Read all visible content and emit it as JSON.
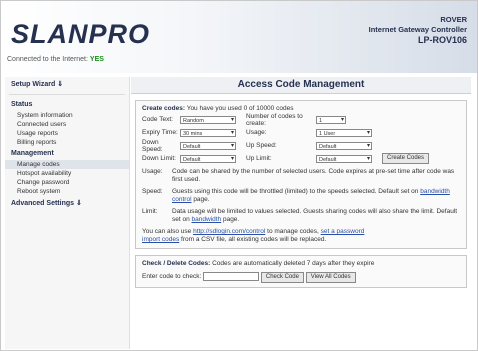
{
  "header": {
    "logo": "SLANPRO",
    "product_name": "ROVER",
    "product_desc": "Internet Gateway Controller",
    "model": "LP-ROV106",
    "connected_label": "Connected to the Internet:",
    "connected_value": "YES"
  },
  "sidebar": {
    "setup_wizard": "Setup Wizard ⇓",
    "status": "Status",
    "status_items": [
      "System information",
      "Connected users",
      "Usage reports",
      "Billing reports"
    ],
    "management": "Management",
    "management_items": [
      "Manage codes",
      "Hotspot availability",
      "Change password",
      "Reboot system"
    ],
    "advanced": "Advanced Settings ⇓"
  },
  "main": {
    "title": "Access Code Management",
    "create": {
      "title": "Create codes:",
      "info": "You have you used 0 of 10000 codes",
      "code_text_label": "Code Text:",
      "code_text_value": "Random",
      "num_codes_label": "Number of codes to create:",
      "num_codes_value": "1",
      "expiry_label": "Expiry Time:",
      "expiry_value": "30 mins",
      "usage_label": "Usage:",
      "usage_value": "1 User",
      "down_speed_label": "Down Speed:",
      "down_speed_value": "Default",
      "up_speed_label": "Up Speed:",
      "up_speed_value": "Default",
      "down_limit_label": "Down Limit:",
      "down_limit_value": "Default",
      "up_limit_label": "Up Limit:",
      "up_limit_value": "Default",
      "create_button": "Create Codes",
      "help_usage_key": "Usage:",
      "help_usage": "Code can be shared by the number of selected users. Code expires at pre-set time after code was first used.",
      "help_speed_key": "Speed:",
      "help_speed_pre": "Guests using this code will be throttled (limited) to the speeds selected. Default set on ",
      "help_speed_link": "bandwidth control",
      "help_speed_post": " page.",
      "help_limit_key": "Limit:",
      "help_limit_pre": "Data usage will be limited to values selected. Guests sharing codes will also share the limit. Default set on ",
      "help_limit_link": "bandwidth",
      "help_limit_post": " page.",
      "also_pre": "You can also use ",
      "also_link1": "http://sdlogin.com/control",
      "also_mid": " to manage codes, ",
      "also_link2": "set a password",
      "import_link": "import codes",
      "import_post": " from a CSV file, all existing codes will be replaced."
    },
    "check": {
      "title": "Check / Delete Codes:",
      "info": "Codes are automatically deleted 7 days after they expire",
      "enter_label": "Enter code to check:",
      "check_button": "Check Code",
      "view_all_button": "View All Codes"
    }
  }
}
